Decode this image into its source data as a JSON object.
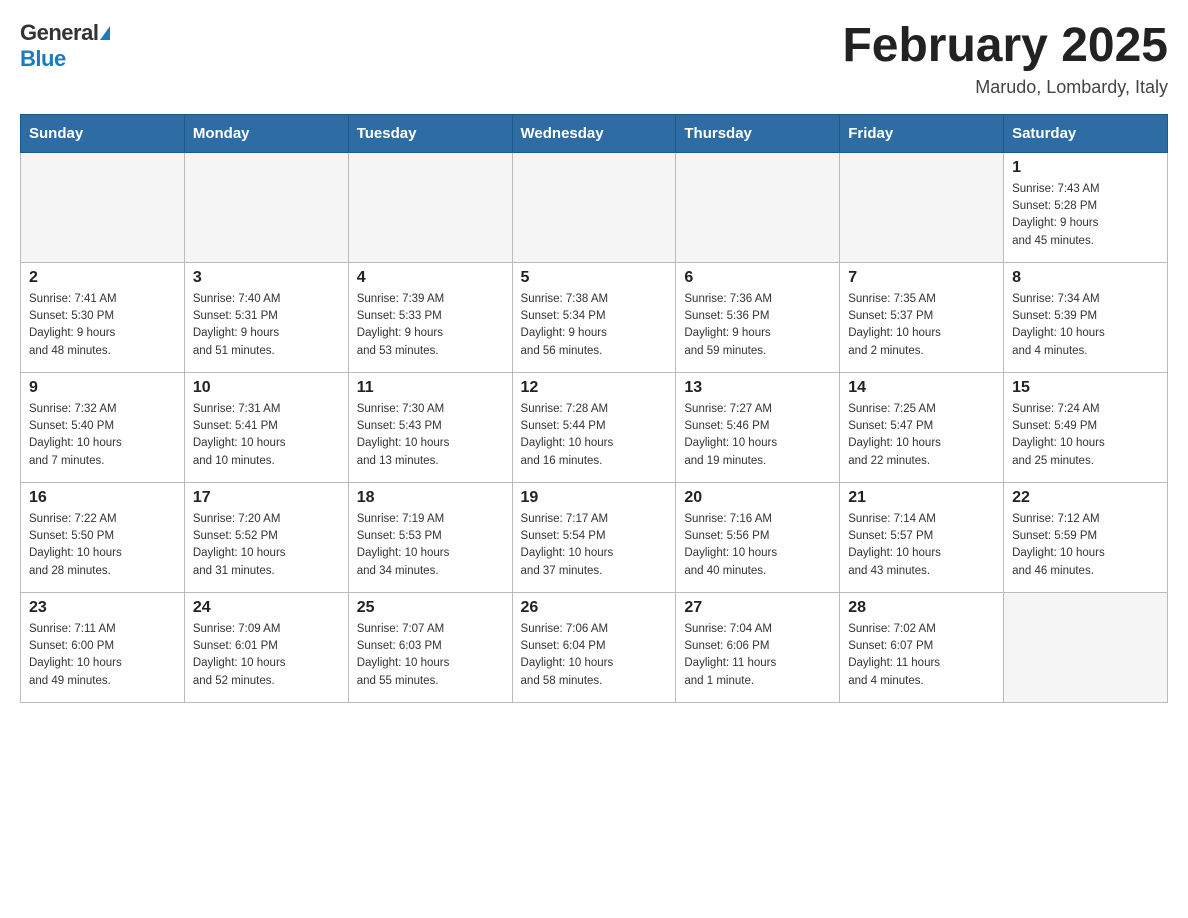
{
  "header": {
    "logo_general": "General",
    "logo_blue": "Blue",
    "title": "February 2025",
    "subtitle": "Marudo, Lombardy, Italy"
  },
  "weekdays": [
    "Sunday",
    "Monday",
    "Tuesday",
    "Wednesday",
    "Thursday",
    "Friday",
    "Saturday"
  ],
  "weeks": [
    [
      {
        "day": "",
        "info": ""
      },
      {
        "day": "",
        "info": ""
      },
      {
        "day": "",
        "info": ""
      },
      {
        "day": "",
        "info": ""
      },
      {
        "day": "",
        "info": ""
      },
      {
        "day": "",
        "info": ""
      },
      {
        "day": "1",
        "info": "Sunrise: 7:43 AM\nSunset: 5:28 PM\nDaylight: 9 hours\nand 45 minutes."
      }
    ],
    [
      {
        "day": "2",
        "info": "Sunrise: 7:41 AM\nSunset: 5:30 PM\nDaylight: 9 hours\nand 48 minutes."
      },
      {
        "day": "3",
        "info": "Sunrise: 7:40 AM\nSunset: 5:31 PM\nDaylight: 9 hours\nand 51 minutes."
      },
      {
        "day": "4",
        "info": "Sunrise: 7:39 AM\nSunset: 5:33 PM\nDaylight: 9 hours\nand 53 minutes."
      },
      {
        "day": "5",
        "info": "Sunrise: 7:38 AM\nSunset: 5:34 PM\nDaylight: 9 hours\nand 56 minutes."
      },
      {
        "day": "6",
        "info": "Sunrise: 7:36 AM\nSunset: 5:36 PM\nDaylight: 9 hours\nand 59 minutes."
      },
      {
        "day": "7",
        "info": "Sunrise: 7:35 AM\nSunset: 5:37 PM\nDaylight: 10 hours\nand 2 minutes."
      },
      {
        "day": "8",
        "info": "Sunrise: 7:34 AM\nSunset: 5:39 PM\nDaylight: 10 hours\nand 4 minutes."
      }
    ],
    [
      {
        "day": "9",
        "info": "Sunrise: 7:32 AM\nSunset: 5:40 PM\nDaylight: 10 hours\nand 7 minutes."
      },
      {
        "day": "10",
        "info": "Sunrise: 7:31 AM\nSunset: 5:41 PM\nDaylight: 10 hours\nand 10 minutes."
      },
      {
        "day": "11",
        "info": "Sunrise: 7:30 AM\nSunset: 5:43 PM\nDaylight: 10 hours\nand 13 minutes."
      },
      {
        "day": "12",
        "info": "Sunrise: 7:28 AM\nSunset: 5:44 PM\nDaylight: 10 hours\nand 16 minutes."
      },
      {
        "day": "13",
        "info": "Sunrise: 7:27 AM\nSunset: 5:46 PM\nDaylight: 10 hours\nand 19 minutes."
      },
      {
        "day": "14",
        "info": "Sunrise: 7:25 AM\nSunset: 5:47 PM\nDaylight: 10 hours\nand 22 minutes."
      },
      {
        "day": "15",
        "info": "Sunrise: 7:24 AM\nSunset: 5:49 PM\nDaylight: 10 hours\nand 25 minutes."
      }
    ],
    [
      {
        "day": "16",
        "info": "Sunrise: 7:22 AM\nSunset: 5:50 PM\nDaylight: 10 hours\nand 28 minutes."
      },
      {
        "day": "17",
        "info": "Sunrise: 7:20 AM\nSunset: 5:52 PM\nDaylight: 10 hours\nand 31 minutes."
      },
      {
        "day": "18",
        "info": "Sunrise: 7:19 AM\nSunset: 5:53 PM\nDaylight: 10 hours\nand 34 minutes."
      },
      {
        "day": "19",
        "info": "Sunrise: 7:17 AM\nSunset: 5:54 PM\nDaylight: 10 hours\nand 37 minutes."
      },
      {
        "day": "20",
        "info": "Sunrise: 7:16 AM\nSunset: 5:56 PM\nDaylight: 10 hours\nand 40 minutes."
      },
      {
        "day": "21",
        "info": "Sunrise: 7:14 AM\nSunset: 5:57 PM\nDaylight: 10 hours\nand 43 minutes."
      },
      {
        "day": "22",
        "info": "Sunrise: 7:12 AM\nSunset: 5:59 PM\nDaylight: 10 hours\nand 46 minutes."
      }
    ],
    [
      {
        "day": "23",
        "info": "Sunrise: 7:11 AM\nSunset: 6:00 PM\nDaylight: 10 hours\nand 49 minutes."
      },
      {
        "day": "24",
        "info": "Sunrise: 7:09 AM\nSunset: 6:01 PM\nDaylight: 10 hours\nand 52 minutes."
      },
      {
        "day": "25",
        "info": "Sunrise: 7:07 AM\nSunset: 6:03 PM\nDaylight: 10 hours\nand 55 minutes."
      },
      {
        "day": "26",
        "info": "Sunrise: 7:06 AM\nSunset: 6:04 PM\nDaylight: 10 hours\nand 58 minutes."
      },
      {
        "day": "27",
        "info": "Sunrise: 7:04 AM\nSunset: 6:06 PM\nDaylight: 11 hours\nand 1 minute."
      },
      {
        "day": "28",
        "info": "Sunrise: 7:02 AM\nSunset: 6:07 PM\nDaylight: 11 hours\nand 4 minutes."
      },
      {
        "day": "",
        "info": ""
      }
    ]
  ]
}
